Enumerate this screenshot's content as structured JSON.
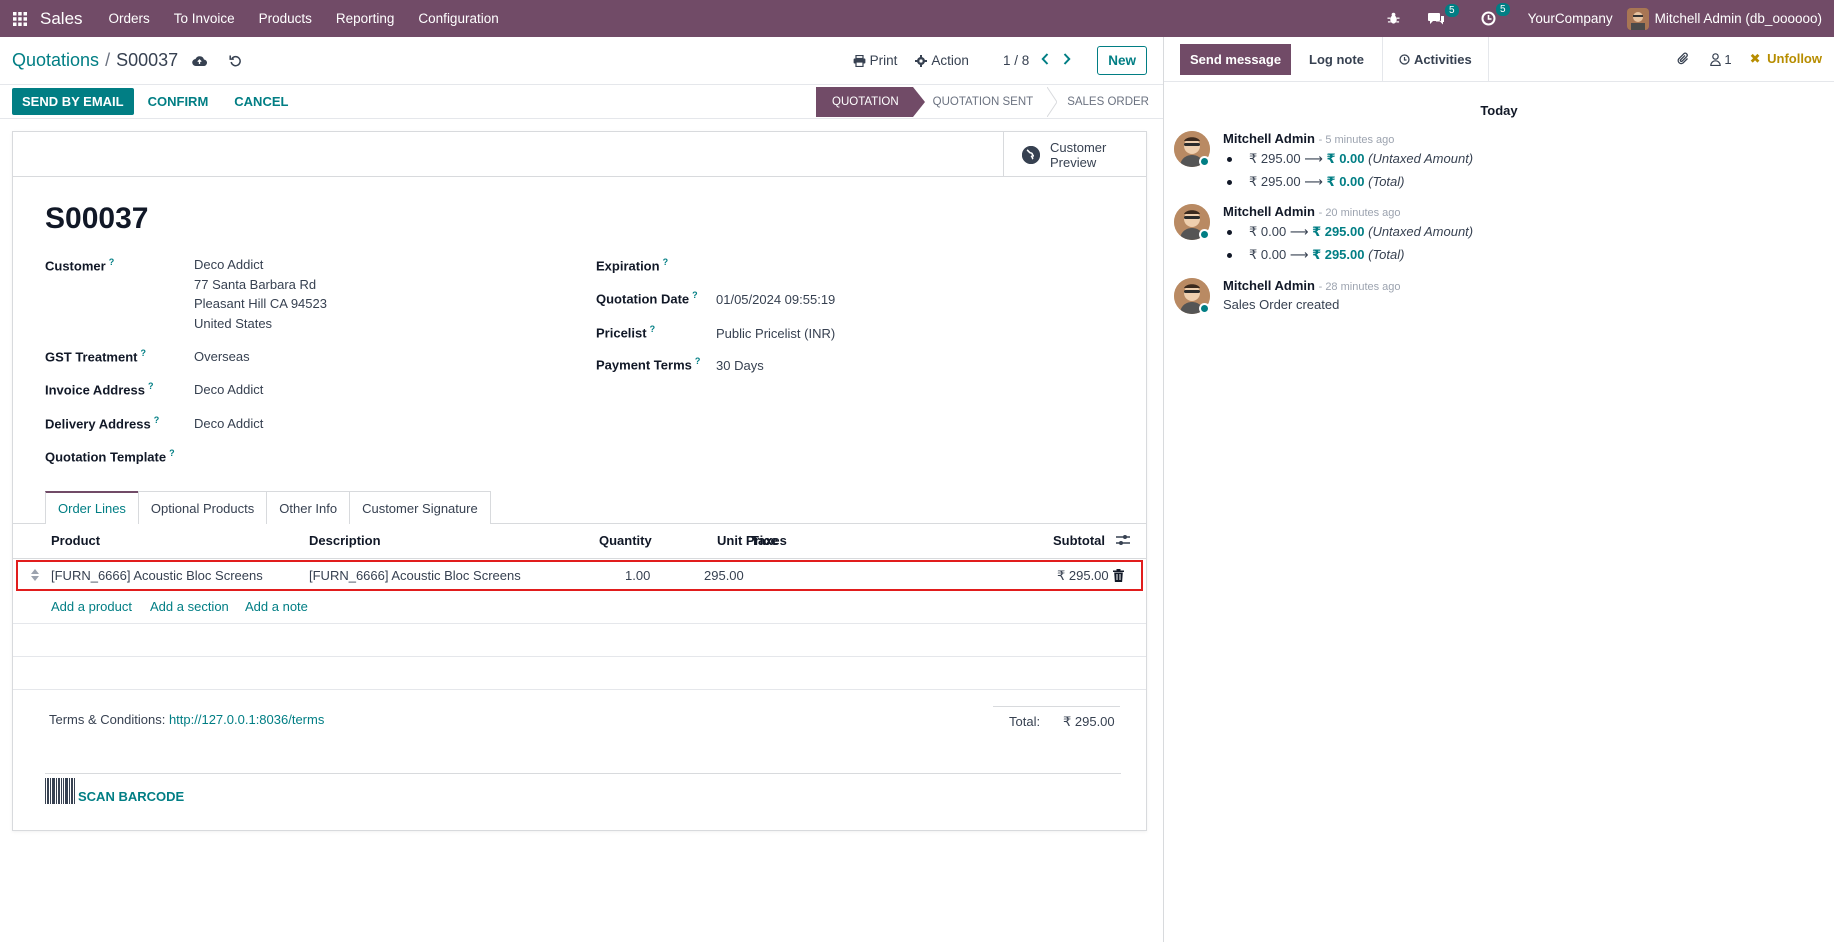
{
  "navbar": {
    "app_name": "Sales",
    "menu": [
      "Orders",
      "To Invoice",
      "Products",
      "Reporting",
      "Configuration"
    ],
    "messages_badge": "5",
    "activities_badge": "5",
    "company": "YourCompany",
    "user": "Mitchell Admin (db_oooooo)"
  },
  "control": {
    "breadcrumb_parent": "Quotations",
    "breadcrumb_sep": "/",
    "breadcrumb_current": "S00037",
    "print": "Print",
    "action": "Action",
    "pager": "1 / 8",
    "new": "New"
  },
  "statusbar": {
    "send_email": "SEND BY EMAIL",
    "confirm": "CONFIRM",
    "cancel": "CANCEL",
    "stages": [
      "QUOTATION",
      "QUOTATION SENT",
      "SALES ORDER"
    ],
    "active_stage": "QUOTATION"
  },
  "form": {
    "customer_preview_1": "Customer",
    "customer_preview_2": "Preview",
    "title": "S00037",
    "customer_label": "Customer",
    "customer_name": "Deco Addict",
    "customer_addr1": "77 Santa Barbara Rd",
    "customer_addr2": "Pleasant Hill CA 94523",
    "customer_addr3": "United States",
    "gst_label": "GST Treatment",
    "gst_value": "Overseas",
    "invoice_label": "Invoice Address",
    "invoice_value": "Deco Addict",
    "delivery_label": "Delivery Address",
    "delivery_value": "Deco Addict",
    "template_label": "Quotation Template",
    "expiration_label": "Expiration",
    "quote_date_label": "Quotation Date",
    "quote_date_value": "01/05/2024 09:55:19",
    "pricelist_label": "Pricelist",
    "pricelist_value": "Public Pricelist (INR)",
    "payment_label": "Payment Terms",
    "payment_value": "30 Days",
    "help_mark": "?"
  },
  "tabs": [
    "Order Lines",
    "Optional Products",
    "Other Info",
    "Customer Signature"
  ],
  "table": {
    "headers": {
      "product": "Product",
      "description": "Description",
      "quantity": "Quantity",
      "unit_price": "Unit Price",
      "taxes": "Taxes",
      "subtotal": "Subtotal"
    },
    "rows": [
      {
        "product": "[FURN_6666] Acoustic Bloc Screens",
        "description": "[FURN_6666] Acoustic Bloc Screens",
        "quantity": "1.00",
        "unit_price": "295.00",
        "taxes": "",
        "subtotal": "₹ 295.00"
      }
    ],
    "add_product": "Add a product",
    "add_section": "Add a section",
    "add_note": "Add a note"
  },
  "footer": {
    "terms_label": "Terms & Conditions:",
    "terms_link": "http://127.0.0.1:8036/terms",
    "total_label": "Total:",
    "total_value": "₹ 295.00",
    "scan_barcode": "SCAN BARCODE"
  },
  "chatter": {
    "send_message": "Send message",
    "log_note": "Log note",
    "activities": "Activities",
    "followers_count": "1",
    "unfollow": "Unfollow",
    "today": "Today",
    "messages": [
      {
        "author": "Mitchell Admin",
        "time": "- 5 minutes ago",
        "changes": [
          {
            "old": "₹ 295.00",
            "new": "₹ 0.00",
            "field": "(Untaxed Amount)"
          },
          {
            "old": "₹ 295.00",
            "new": "₹ 0.00",
            "field": "(Total)"
          }
        ]
      },
      {
        "author": "Mitchell Admin",
        "time": "- 20 minutes ago",
        "changes": [
          {
            "old": "₹ 0.00",
            "new": "₹ 295.00",
            "field": "(Untaxed Amount)"
          },
          {
            "old": "₹ 0.00",
            "new": "₹ 295.00",
            "field": "(Total)"
          }
        ]
      },
      {
        "author": "Mitchell Admin",
        "time": "- 28 minutes ago",
        "body": "Sales Order created"
      }
    ]
  },
  "colors": {
    "brand": "#714B67",
    "accent": "#017E84",
    "highlight": "#e11d1d",
    "unfollow": "#b78d00"
  }
}
